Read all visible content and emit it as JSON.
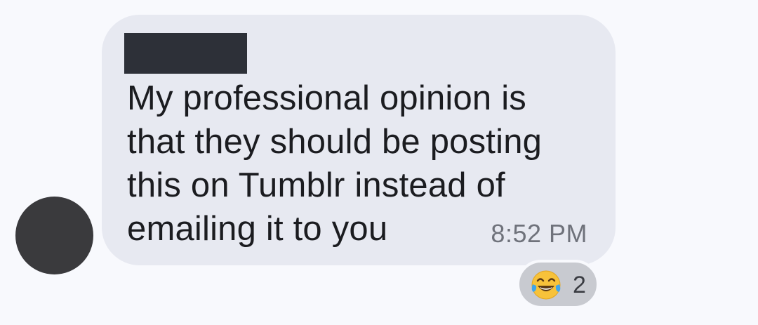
{
  "message": {
    "text": "My professional opinion is\nthat they should be posting\nthis on Tumblr instead of\nemailing it to you",
    "timestamp": "8:52 PM"
  },
  "reaction": {
    "emoji": "face-with-tears-of-joy-icon",
    "count": "2"
  },
  "colors": {
    "background": "#f8f9fd",
    "bubble": "#e7e9f1",
    "avatar": "#3a3a3d",
    "redaction": "#2d3038"
  }
}
